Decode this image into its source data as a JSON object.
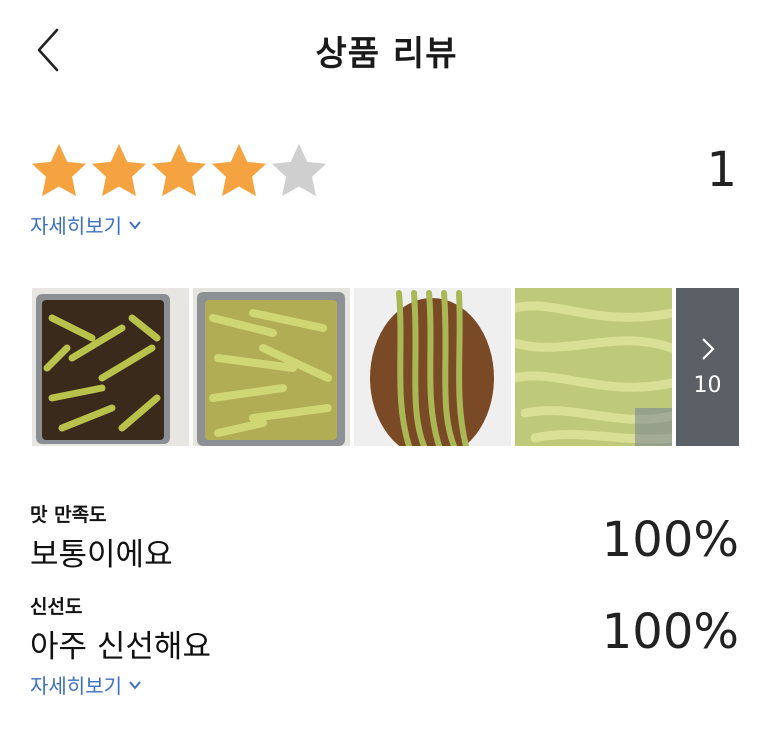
{
  "header": {
    "title": "상품 리뷰",
    "back_icon": "chevron-left-icon"
  },
  "rating": {
    "stars_filled": 4,
    "stars_total": 5,
    "count": "1",
    "star_color": "#f4a340",
    "star_empty_color": "#cfcfcf"
  },
  "detail_link_1": {
    "label": "자세히보기"
  },
  "photos": {
    "thumbnails": 4,
    "more_count": "10",
    "more_icon": "chevron-right-icon"
  },
  "metrics": [
    {
      "label": "맛 만족도",
      "value": "보통이에요",
      "percent": "100%"
    },
    {
      "label": "신선도",
      "value": "아주 신선해요",
      "percent": "100%"
    }
  ],
  "detail_link_2": {
    "label": "자세히보기"
  },
  "colors": {
    "link": "#3d6fc2",
    "more_tile_bg": "#5b5f66"
  }
}
